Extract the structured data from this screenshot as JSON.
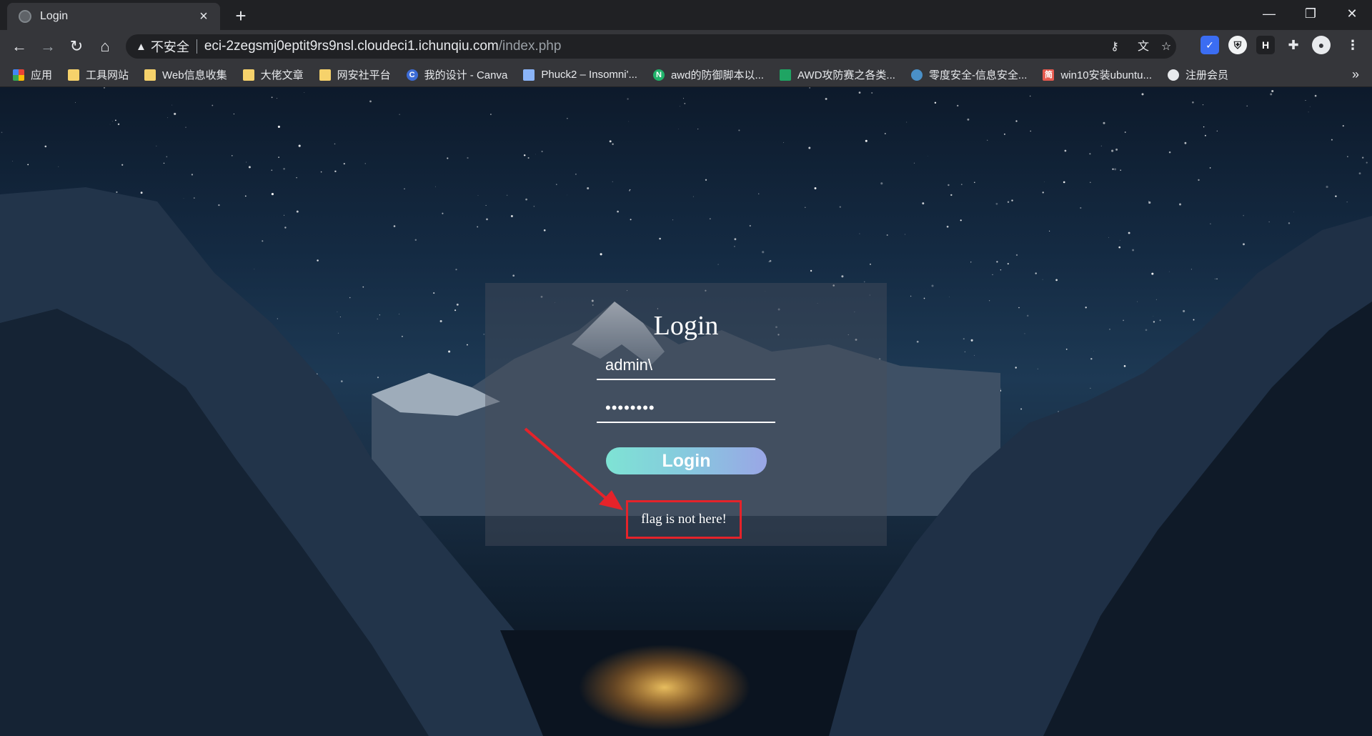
{
  "browser": {
    "tab_title": "Login",
    "url_insecure_label": "不安全",
    "url_host": "eci-2zegsmj0eptit9rs9nsl.cloudeci1.ichunqiu.com",
    "url_path": "/index.php",
    "ext_h_letter": "H",
    "more_bookmarks": "»"
  },
  "bookmarks": [
    {
      "label": "应用",
      "icon": "apps-grid-icon"
    },
    {
      "label": "工具网站",
      "icon": "folder-icon"
    },
    {
      "label": "Web信息收集",
      "icon": "folder-icon"
    },
    {
      "label": "大佬文章",
      "icon": "folder-icon"
    },
    {
      "label": "网安社平台",
      "icon": "folder-icon"
    },
    {
      "label": "我的设计 - Canva",
      "icon": "canva-icon",
      "icon_text": "C"
    },
    {
      "label": "Phuck2 – Insomni'...",
      "icon": "page-icon"
    },
    {
      "label": "awd的防御脚本以...",
      "icon": "n-icon",
      "icon_text": "N"
    },
    {
      "label": "AWD攻防赛之各类...",
      "icon": "sheet-icon"
    },
    {
      "label": "零度安全-信息安全...",
      "icon": "globe-icon"
    },
    {
      "label": "win10安装ubuntu...",
      "icon": "jian-icon",
      "icon_text": "简"
    },
    {
      "label": "注册会员",
      "icon": "world-icon"
    }
  ],
  "login": {
    "heading": "Login",
    "username_value": "admin\\",
    "password_value": "••••••••",
    "button_label": "Login",
    "message": "flag is not here!"
  },
  "colors": {
    "annotation_red": "#e5232a",
    "button_gradient_start": "#7ee3d4",
    "button_gradient_end": "#9aa6e6"
  }
}
